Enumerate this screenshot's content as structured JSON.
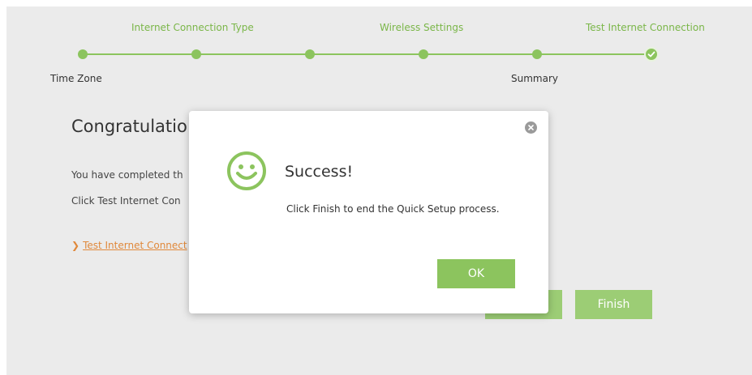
{
  "stepper": {
    "top_labels": [
      "Internet Connection Type",
      "Wireless Settings",
      "Test Internet Connection"
    ],
    "bottom_labels": [
      "Time Zone",
      "Summary"
    ],
    "accent_color": "#8cc45e",
    "completed_icon": "check-circle-icon"
  },
  "content": {
    "title": "Congratulatio",
    "line1": "You have completed th",
    "line2": "Click Test Internet Con",
    "link": "Test Internet Connect",
    "back_button_label": "",
    "finish_button_label": "Finish"
  },
  "modal": {
    "icon": "smiley-icon",
    "title": "Success!",
    "message": "Click Finish to end the Quick Setup process.",
    "ok_label": "OK",
    "close_icon": "close-icon"
  }
}
